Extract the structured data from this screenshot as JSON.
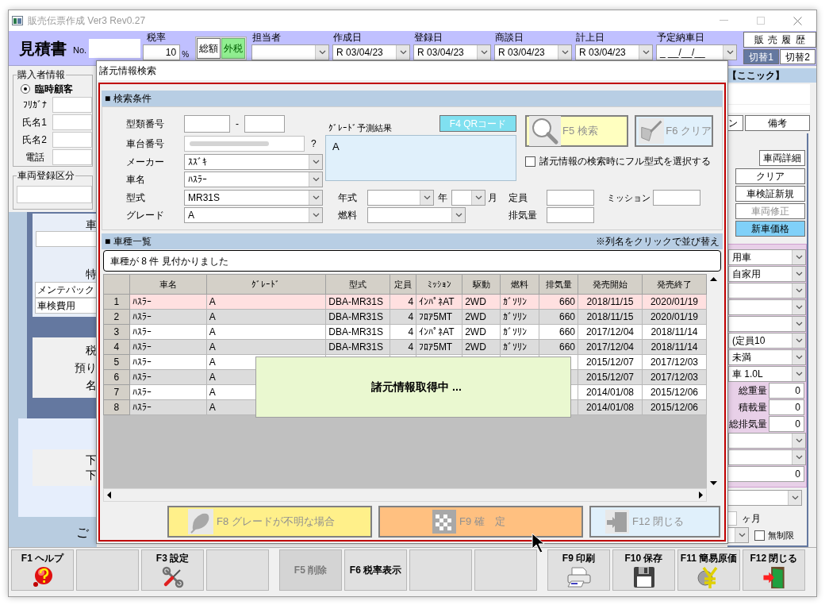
{
  "window": {
    "title": "販売伝票作成 Ver3 Rev0.27"
  },
  "header": {
    "doc_title": "見積書",
    "no_label": "No.",
    "tax_rate": {
      "label": "税率",
      "value": "10",
      "unit": "%"
    },
    "tax_modes": [
      {
        "label": "総額",
        "selected": false
      },
      {
        "label": "外税",
        "selected": true
      }
    ],
    "date_fields": [
      {
        "label": "担当者"
      },
      {
        "label": "作成日",
        "value": "R 03/04/23"
      },
      {
        "label": "登録日",
        "value": "R 03/04/23"
      },
      {
        "label": "商談日",
        "value": "R 03/04/23"
      },
      {
        "label": "計上日",
        "value": "R 03/04/23"
      },
      {
        "label": "予定納車日",
        "value": "_ __/__/__"
      }
    ],
    "history_button": "販 売 履 歴",
    "switch_tabs": [
      {
        "label": "切替1",
        "selected": true
      },
      {
        "label": "切替2",
        "selected": false
      }
    ]
  },
  "buyer": {
    "title": "購入者情報",
    "radio": {
      "label": "臨時顧客",
      "checked": true
    },
    "fields": [
      "ﾌﾘｶﾞﾅ",
      "氏名1",
      "氏名2",
      "電話"
    ]
  },
  "registration": {
    "title": "車両登録区分"
  },
  "left_panel": {
    "top_label": "車",
    "special_label": "特",
    "items": [
      "メンテパック",
      "車検費用"
    ],
    "money_labels": [
      "税",
      "預り",
      "名"
    ],
    "lower_labels": [
      "下",
      "下"
    ],
    "bottom_label": "ご"
  },
  "right_panel": {
    "header": "【ここック】",
    "tabs": [
      "ン",
      "備考"
    ],
    "buttons": [
      {
        "label": "車両詳細",
        "disabled": false,
        "highlighted": false
      },
      {
        "label": "クリア",
        "disabled": false,
        "highlighted": false
      },
      {
        "label": "車検証新規",
        "disabled": false,
        "highlighted": false
      },
      {
        "label": "車両修正",
        "disabled": true,
        "highlighted": false
      },
      {
        "label": "新車価格",
        "disabled": false,
        "highlighted": true
      }
    ],
    "rows": [
      {
        "kind": "combo",
        "value": "用車"
      },
      {
        "kind": "combo",
        "value": "自家用"
      },
      {
        "kind": "combo"
      },
      {
        "kind": "combo"
      },
      {
        "kind": "combo"
      },
      {
        "kind": "combo",
        "value": "(定員10"
      },
      {
        "kind": "combo",
        "value": "未満"
      },
      {
        "kind": "combo",
        "value": "車 1.0L"
      },
      {
        "kind": "field",
        "label": "総重量",
        "value": "0"
      },
      {
        "kind": "field",
        "label": "積載量",
        "value": "0"
      },
      {
        "kind": "field",
        "label": "総排気量",
        "value": "0"
      },
      {
        "kind": "combo"
      },
      {
        "kind": "combo"
      },
      {
        "kind": "field",
        "value": "0"
      }
    ],
    "months_unit": "ヶ月",
    "unlimited": {
      "label": "無制限",
      "checked": false
    }
  },
  "footer_keys": [
    {
      "kind": "help",
      "label": "F1 ヘルプ",
      "disabled": false
    },
    {
      "kind": "empty"
    },
    {
      "kind": "settings",
      "label": "F3 設定",
      "disabled": false
    },
    {
      "kind": "empty"
    },
    {
      "kind": "text",
      "label": "F5 削除",
      "disabled": true
    },
    {
      "kind": "text",
      "label": "F6 税率表示",
      "disabled": false
    },
    {
      "kind": "empty"
    },
    {
      "kind": "empty"
    },
    {
      "kind": "print",
      "label": "F9 印刷",
      "disabled": false
    },
    {
      "kind": "save",
      "label": "F10 保存",
      "disabled": false
    },
    {
      "kind": "cost",
      "label": "F11 簡易原価",
      "disabled": false
    },
    {
      "kind": "close",
      "label": "F12 閉じる",
      "disabled": false
    }
  ],
  "dialog": {
    "title": "諸元情報検索",
    "search": {
      "title": "■ 検索条件",
      "type_no_label": "型類番号",
      "type_no_separator": "-",
      "chassis_label": "車台番号",
      "chassis_help": "?",
      "combos": [
        {
          "label": "メーカー",
          "value": "ｽｽﾞｷ"
        },
        {
          "label": "車名",
          "value": "ﾊｽﾗｰ"
        }
      ],
      "model": {
        "label": "型式",
        "value": "MR31S"
      },
      "grade": {
        "label": "グレード",
        "value": "A"
      },
      "grade_result": {
        "label": "ｸﾞﾚｰﾄﾞ予測結果",
        "value": "A"
      },
      "qr_button": "F4 QRコード",
      "buttons": [
        {
          "kind": "search",
          "label": "F5 検索"
        },
        {
          "kind": "clear",
          "label": "F6 クリア"
        }
      ],
      "full_model": {
        "label": "諸元情報の検索時にフル型式を選択する",
        "checked": false
      },
      "year": {
        "label": "年式",
        "year_unit": "年",
        "month_unit": "月"
      },
      "fuel_label": "燃料",
      "capacity_label": "定員",
      "displacement_label": "排気量",
      "mission_label": "ミッション"
    },
    "list": {
      "title": "■ 車種一覧",
      "note": "※列名をクリックで並び替え",
      "message": "車種が 8 件 見付かりました",
      "columns": [
        "車名",
        "ｸﾞﾚｰﾄﾞ",
        "型式",
        "定員",
        "ﾐｯｼｮﾝ",
        "駆動",
        "燃料",
        "排気量",
        "発売開始",
        "発売終了"
      ],
      "rows": [
        {
          "no": "1",
          "name": "ﾊｽﾗｰ",
          "grade": "A",
          "model": "DBA-MR31S",
          "capacity": "4",
          "mission": "ｲﾝﾊﾟﾈAT",
          "drive": "2WD",
          "fuel": "ｶﾞｿﾘﾝ",
          "displacement": "660",
          "start": "2018/11/15",
          "end": "2020/01/19",
          "selected": true
        },
        {
          "no": "2",
          "name": "ﾊｽﾗｰ",
          "grade": "A",
          "model": "DBA-MR31S",
          "capacity": "4",
          "mission": "ﾌﾛｱ5MT",
          "drive": "2WD",
          "fuel": "ｶﾞｿﾘﾝ",
          "displacement": "660",
          "start": "2018/11/15",
          "end": "2020/01/19",
          "selected": false
        },
        {
          "no": "3",
          "name": "ﾊｽﾗｰ",
          "grade": "A",
          "model": "DBA-MR31S",
          "capacity": "4",
          "mission": "ｲﾝﾊﾟﾈAT",
          "drive": "2WD",
          "fuel": "ｶﾞｿﾘﾝ",
          "displacement": "660",
          "start": "2017/12/04",
          "end": "2018/11/14",
          "selected": false
        },
        {
          "no": "4",
          "name": "ﾊｽﾗｰ",
          "grade": "A",
          "model": "DBA-MR31S",
          "capacity": "4",
          "mission": "ﾌﾛｱ5MT",
          "drive": "2WD",
          "fuel": "ｶﾞｿﾘﾝ",
          "displacement": "660",
          "start": "2017/12/04",
          "end": "2018/11/14",
          "selected": false
        },
        {
          "no": "5",
          "name": "ﾊｽﾗｰ",
          "grade": "A",
          "start": "2015/12/07",
          "end": "2017/12/03",
          "selected": false
        },
        {
          "no": "6",
          "name": "ﾊｽﾗｰ",
          "grade": "A",
          "start": "2015/12/07",
          "end": "2017/12/03",
          "selected": false
        },
        {
          "no": "7",
          "name": "ﾊｽﾗｰ",
          "grade": "A",
          "start": "2014/01/08",
          "end": "2015/12/06",
          "selected": false
        },
        {
          "no": "8",
          "name": "ﾊｽﾗｰ",
          "grade": "A",
          "start": "2014/01/08",
          "end": "2015/12/06",
          "selected": false
        }
      ]
    },
    "loading": "諸元情報取得中 ...",
    "actions": [
      {
        "kind": "unknown",
        "label": "F8 グレードが不明な場合"
      },
      {
        "kind": "confirm",
        "label": "F9 確　定"
      },
      {
        "kind": "close",
        "label": "F12 閉じる"
      }
    ]
  }
}
